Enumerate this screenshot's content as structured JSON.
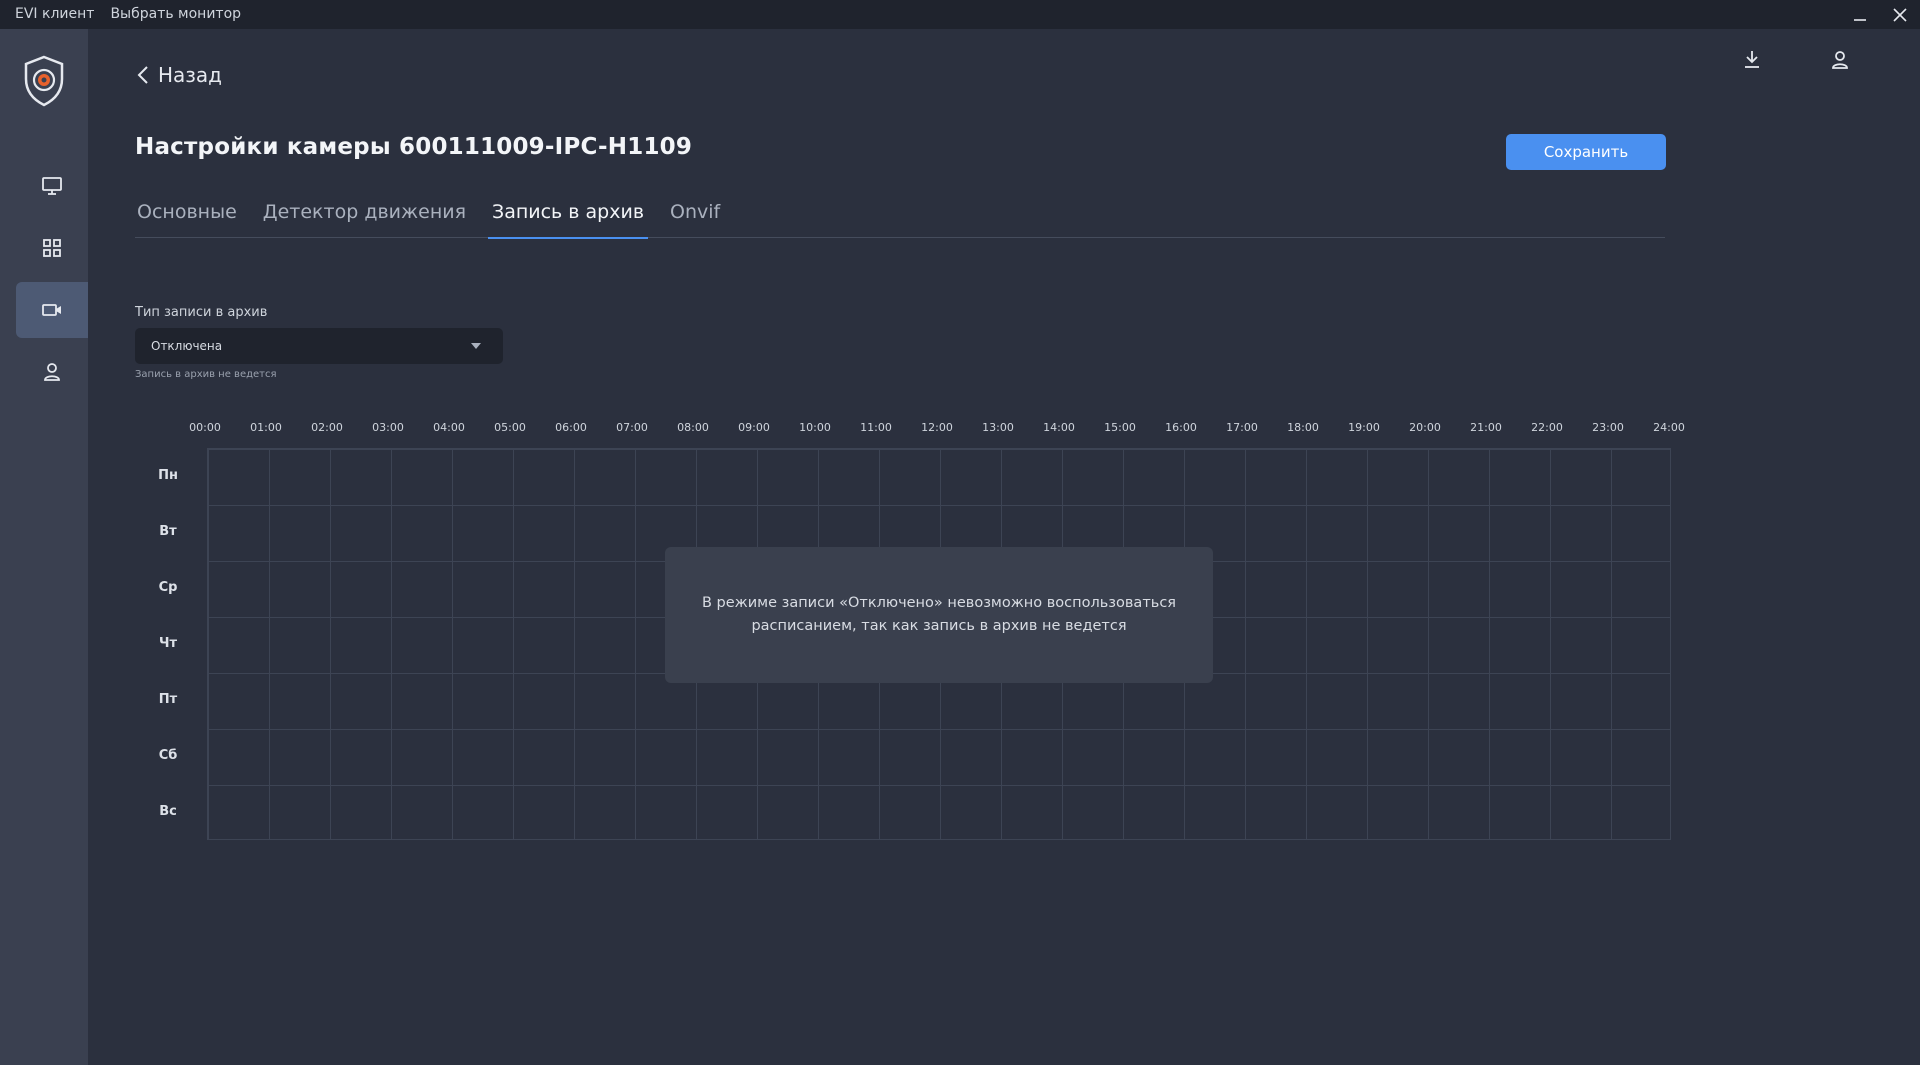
{
  "titlebar": {
    "app_name": "EVI клиент",
    "menu_monitor": "Выбрать монитор"
  },
  "sidebar": {
    "items": [
      {
        "name": "monitor",
        "icon": "monitor-icon",
        "active": false
      },
      {
        "name": "grid",
        "icon": "grid-icon",
        "active": false
      },
      {
        "name": "camera",
        "icon": "camera-icon",
        "active": true
      },
      {
        "name": "user",
        "icon": "user-icon",
        "active": false
      }
    ]
  },
  "header": {
    "back_label": "Назад",
    "title": "Настройки камеры 600111009-IPC-H1109",
    "save_label": "Сохранить",
    "icons": [
      "download-icon",
      "profile-icon"
    ]
  },
  "tabs": [
    {
      "label": "Основные",
      "active": false
    },
    {
      "label": "Детектор движения",
      "active": false
    },
    {
      "label": "Запись в архив",
      "active": true
    },
    {
      "label": "Onvif",
      "active": false
    }
  ],
  "archive": {
    "type_label": "Тип записи в архив",
    "type_value": "Отключена",
    "hint": "Запись в архив не ведется"
  },
  "schedule": {
    "hours": [
      "00:00",
      "01:00",
      "02:00",
      "03:00",
      "04:00",
      "05:00",
      "06:00",
      "07:00",
      "08:00",
      "09:00",
      "10:00",
      "11:00",
      "12:00",
      "13:00",
      "14:00",
      "15:00",
      "16:00",
      "17:00",
      "18:00",
      "19:00",
      "20:00",
      "21:00",
      "22:00",
      "23:00",
      "24:00"
    ],
    "days": [
      "Пн",
      "Вт",
      "Ср",
      "Чт",
      "Пт",
      "Сб",
      "Вс"
    ],
    "disabled_message": "В режиме записи «Отключено» невозможно воспользоваться расписанием, так как запись в архив не ведется"
  },
  "colors": {
    "accent": "#4a90f0",
    "background": "#2b303e",
    "sidebar": "#3a4050"
  }
}
